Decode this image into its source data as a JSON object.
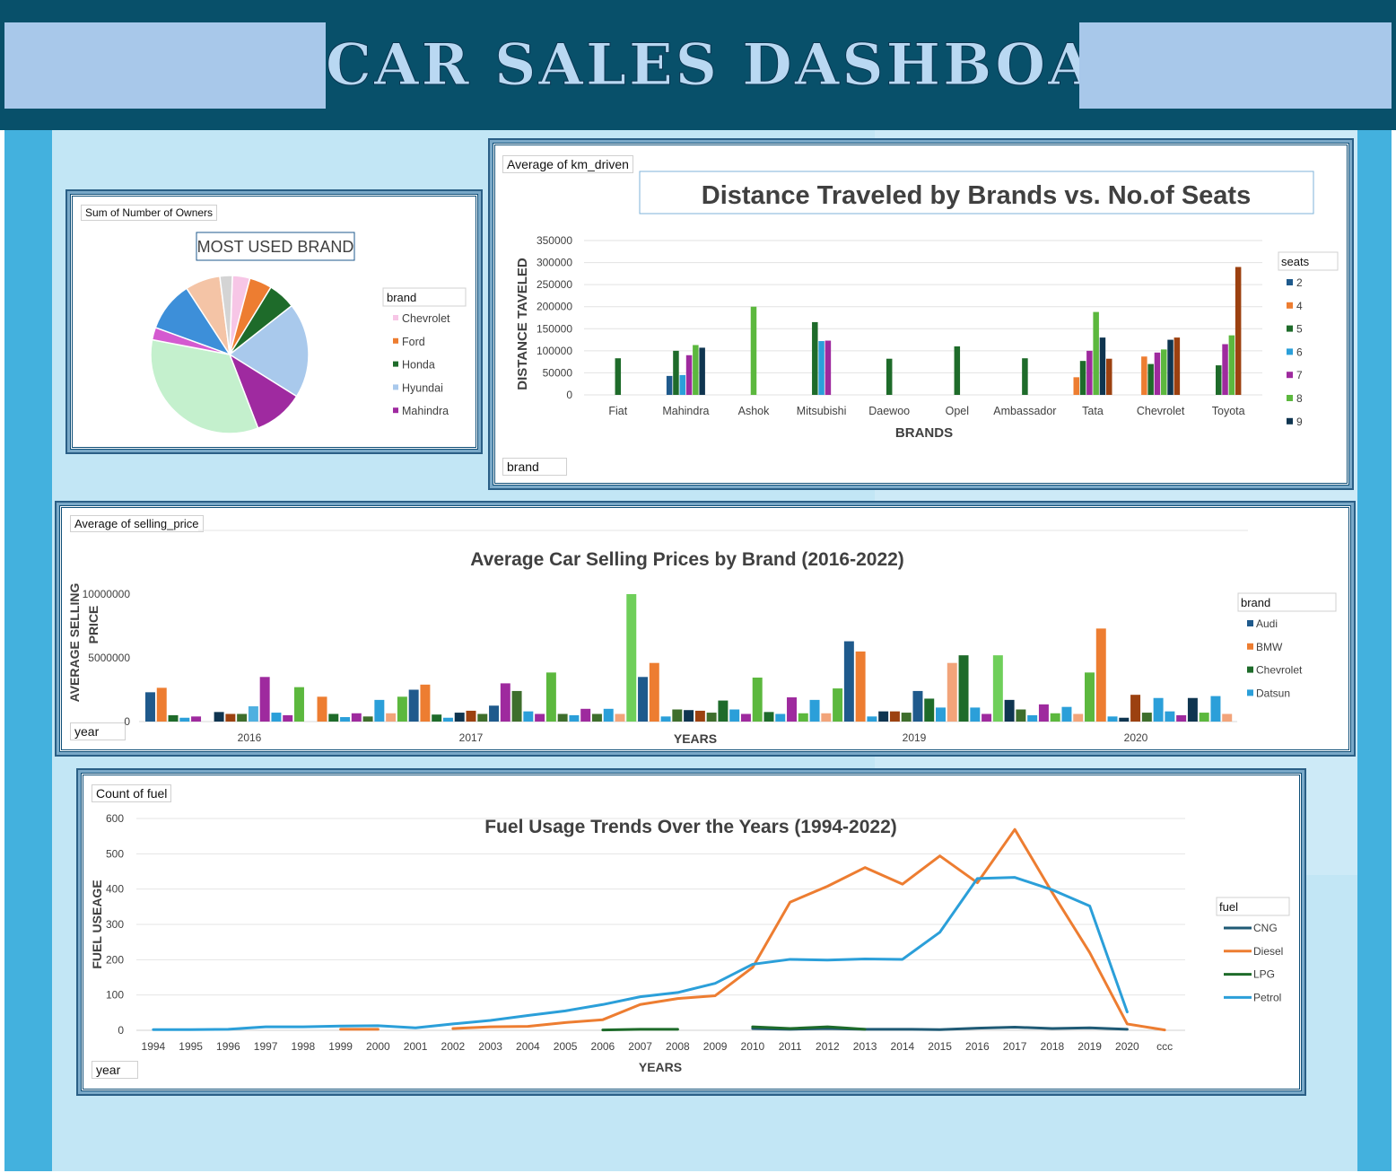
{
  "dashboard": {
    "title": "CAR SALES DASHBOARD"
  },
  "colors": {
    "banner_dark": "#08506a",
    "banner_light": "#a8c8ea",
    "side_blue": "#43b1de",
    "canvas": "#c2e6f5"
  },
  "pie_panel": {
    "field_button": "Sum of Number of Owners",
    "title": "MOST USED BRAND",
    "legend_title": "brand"
  },
  "bar1_panel": {
    "field_button": "Average of km_driven",
    "filter_button": "brand",
    "legend_title": "seats"
  },
  "bar2_panel": {
    "field_button": "Average of selling_price",
    "filter_button": "year",
    "legend_title": "brand"
  },
  "line_panel": {
    "field_button": "Count of fuel",
    "filter_button": "year",
    "legend_title": "fuel"
  },
  "chart_data": [
    {
      "type": "pie",
      "title": "MOST USED BRAND",
      "legend_title": "brand",
      "slices": [
        {
          "label": "Chevrolet",
          "value": 3.5,
          "color": "#f7c6e6"
        },
        {
          "label": "Ford",
          "value": 4.5,
          "color": "#ed7d31"
        },
        {
          "label": "Honda",
          "value": 5.5,
          "color": "#1e6b2a"
        },
        {
          "label": "Hyundai",
          "value": 19,
          "color": "#a9c9ec"
        },
        {
          "label": "Mahindra",
          "value": 10,
          "color": "#9f2aa0"
        },
        {
          "label": "",
          "value": 33,
          "color": "#c4f0cd"
        },
        {
          "label": "",
          "value": 2.5,
          "color": "#d45ad0"
        },
        {
          "label": "",
          "value": 10,
          "color": "#3d8fd9"
        },
        {
          "label": "",
          "value": 7,
          "color": "#f4c4a6"
        },
        {
          "label": "",
          "value": 2.5,
          "color": "#d4d4d4"
        }
      ],
      "legend": [
        "Chevrolet",
        "Ford",
        "Honda",
        "Hyundai",
        "Mahindra"
      ]
    },
    {
      "type": "bar",
      "title": "Distance Traveled by Brands vs. No.of Seats",
      "xlabel": "BRANDS",
      "ylabel": "DISTANCE TAVELED",
      "ylim": [
        0,
        350000
      ],
      "yticks": [
        0,
        50000,
        100000,
        150000,
        200000,
        250000,
        300000,
        350000
      ],
      "categories": [
        "Fiat",
        "Mahindra",
        "Ashok",
        "Mitsubishi",
        "Daewoo",
        "Opel",
        "Ambassador",
        "Tata",
        "Chevrolet",
        "Toyota"
      ],
      "legend_title": "seats",
      "series": [
        {
          "name": "2",
          "color": "#1f5a8c",
          "values": [
            null,
            43000,
            null,
            null,
            null,
            null,
            null,
            null,
            null,
            null
          ]
        },
        {
          "name": "4",
          "color": "#ed7d31",
          "values": [
            null,
            null,
            null,
            null,
            null,
            null,
            null,
            40000,
            87000,
            null
          ]
        },
        {
          "name": "5",
          "color": "#1e6b2a",
          "values": [
            83000,
            100000,
            null,
            165000,
            82000,
            110000,
            83000,
            77000,
            70000,
            67000
          ]
        },
        {
          "name": "6",
          "color": "#2b9fd9",
          "values": [
            null,
            45000,
            null,
            122000,
            null,
            null,
            null,
            null,
            null,
            null
          ]
        },
        {
          "name": "7",
          "color": "#9e2a9e",
          "values": [
            null,
            90000,
            null,
            123000,
            null,
            null,
            null,
            100000,
            96000,
            115000
          ]
        },
        {
          "name": "8",
          "color": "#5cb83e",
          "values": [
            null,
            113000,
            200000,
            null,
            null,
            null,
            null,
            188000,
            103000,
            135000
          ]
        },
        {
          "name": "9",
          "color": "#0f3550",
          "values": [
            null,
            107000,
            null,
            null,
            null,
            null,
            null,
            130000,
            125000,
            null
          ]
        },
        {
          "name": "",
          "color": "#9c4110",
          "values": [
            null,
            null,
            null,
            null,
            null,
            null,
            null,
            82000,
            130000,
            290000
          ]
        }
      ]
    },
    {
      "type": "bar",
      "title": "Average Car Selling Prices by Brand (2016-2022)",
      "xlabel": "YEARS",
      "ylabel": "AVERAGE SELLING PRICE",
      "ylim": [
        0,
        10000000
      ],
      "yticks": [
        0,
        5000000,
        10000000
      ],
      "year_labels": [
        "2016",
        "2017",
        "2019",
        "2020"
      ],
      "legend_title": "brand",
      "legend": [
        {
          "name": "Audi",
          "color": "#1f5a8c"
        },
        {
          "name": "BMW",
          "color": "#ed7d31"
        },
        {
          "name": "Chevrolet",
          "color": "#1e6b2a"
        },
        {
          "name": "Datsun",
          "color": "#2b9fd9"
        }
      ],
      "palette": [
        "#1f5a8c",
        "#ed7d31",
        "#1e6b2a",
        "#2b9fd9",
        "#9e2a9e",
        "#5cb83e",
        "#0f3550",
        "#9c4110",
        "#3e6e2c",
        "#4fb0e0",
        "#f2a47a",
        "#6fcf5a"
      ],
      "bars": [
        [
          2300000,
          0
        ],
        [
          2650000,
          1
        ],
        [
          500000,
          2
        ],
        [
          300000,
          3
        ],
        [
          400000,
          4
        ],
        [
          0,
          5
        ],
        [
          750000,
          6
        ],
        [
          600000,
          7
        ],
        [
          600000,
          8
        ],
        [
          1200000,
          9
        ],
        [
          3500000,
          4
        ],
        [
          700000,
          3
        ],
        [
          500000,
          4
        ],
        [
          2700000,
          5
        ],
        [
          0,
          6
        ],
        [
          1950000,
          1
        ],
        [
          600000,
          2
        ],
        [
          350000,
          3
        ],
        [
          650000,
          4
        ],
        [
          400000,
          8
        ],
        [
          1700000,
          3
        ],
        [
          650000,
          10
        ],
        [
          1950000,
          5
        ],
        [
          2500000,
          0
        ],
        [
          2900000,
          1
        ],
        [
          550000,
          2
        ],
        [
          300000,
          3
        ],
        [
          700000,
          6
        ],
        [
          850000,
          7
        ],
        [
          600000,
          8
        ],
        [
          1250000,
          0
        ],
        [
          3000000,
          4
        ],
        [
          2400000,
          8
        ],
        [
          800000,
          3
        ],
        [
          600000,
          4
        ],
        [
          3850000,
          5
        ],
        [
          600000,
          8
        ],
        [
          500000,
          3
        ],
        [
          1000000,
          4
        ],
        [
          600000,
          8
        ],
        [
          1000000,
          3
        ],
        [
          600000,
          10
        ],
        [
          10000000,
          11
        ],
        [
          3500000,
          0
        ],
        [
          4600000,
          1
        ],
        [
          400000,
          3
        ],
        [
          950000,
          8
        ],
        [
          900000,
          6
        ],
        [
          850000,
          7
        ],
        [
          700000,
          8
        ],
        [
          1650000,
          2
        ],
        [
          950000,
          3
        ],
        [
          600000,
          4
        ],
        [
          3450000,
          5
        ],
        [
          750000,
          2
        ],
        [
          600000,
          3
        ],
        [
          1900000,
          4
        ],
        [
          650000,
          5
        ],
        [
          1700000,
          3
        ],
        [
          650000,
          10
        ],
        [
          2600000,
          5
        ],
        [
          6300000,
          0
        ],
        [
          5500000,
          1
        ],
        [
          400000,
          3
        ],
        [
          800000,
          6
        ],
        [
          800000,
          7
        ],
        [
          700000,
          8
        ],
        [
          2400000,
          0
        ],
        [
          1800000,
          2
        ],
        [
          1100000,
          3
        ],
        [
          4600000,
          10
        ],
        [
          5200000,
          2
        ],
        [
          1100000,
          3
        ],
        [
          600000,
          4
        ],
        [
          5200000,
          11
        ],
        [
          1700000,
          6
        ],
        [
          950000,
          8
        ],
        [
          500000,
          3
        ],
        [
          1350000,
          4
        ],
        [
          650000,
          5
        ],
        [
          1150000,
          3
        ],
        [
          600000,
          10
        ],
        [
          3850000,
          5
        ],
        [
          7300000,
          1
        ],
        [
          400000,
          3
        ],
        [
          300000,
          6
        ],
        [
          2100000,
          7
        ],
        [
          700000,
          8
        ],
        [
          1850000,
          3
        ],
        [
          800000,
          3
        ],
        [
          500000,
          4
        ],
        [
          1850000,
          6
        ],
        [
          700000,
          5
        ],
        [
          2000000,
          3
        ],
        [
          600000,
          10
        ]
      ]
    },
    {
      "type": "line",
      "title": "Fuel Usage Trends Over the Years (1994-2022)",
      "xlabel": "YEARS",
      "ylabel": "FUEL USEAGE",
      "ylim": [
        0,
        600
      ],
      "yticks": [
        0,
        100,
        200,
        300,
        400,
        500,
        600
      ],
      "categories": [
        "1994",
        "1995",
        "1996",
        "1997",
        "1998",
        "1999",
        "2000",
        "2001",
        "2002",
        "2003",
        "2004",
        "2005",
        "2006",
        "2007",
        "2008",
        "2009",
        "2010",
        "2011",
        "2012",
        "2013",
        "2014",
        "2015",
        "2016",
        "2017",
        "2018",
        "2019",
        "2020",
        "ccc"
      ],
      "legend_title": "fuel",
      "series": [
        {
          "name": "CNG",
          "color": "#1f5a75",
          "values": [
            null,
            null,
            null,
            null,
            null,
            null,
            null,
            null,
            null,
            null,
            null,
            null,
            null,
            null,
            null,
            null,
            5,
            3,
            5,
            3,
            3,
            2,
            6,
            9,
            5,
            7,
            3,
            null
          ]
        },
        {
          "name": "Diesel",
          "color": "#ed7d31",
          "values": [
            null,
            null,
            null,
            null,
            null,
            3,
            3,
            null,
            5,
            10,
            11,
            22,
            30,
            73,
            90,
            98,
            178,
            363,
            408,
            461,
            414,
            494,
            418,
            569,
            390,
            220,
            18,
            1
          ]
        },
        {
          "name": "LPG",
          "color": "#1e6b2a",
          "values": [
            null,
            null,
            null,
            null,
            null,
            null,
            null,
            null,
            null,
            null,
            null,
            null,
            1,
            3,
            3,
            null,
            10,
            5,
            10,
            3,
            null,
            null,
            null,
            null,
            null,
            null,
            null,
            null
          ]
        },
        {
          "name": "Petrol",
          "color": "#2b9fd9",
          "values": [
            2,
            2,
            3,
            10,
            10,
            12,
            13,
            7,
            18,
            28,
            42,
            55,
            73,
            95,
            107,
            133,
            187,
            201,
            199,
            202,
            201,
            278,
            430,
            433,
            398,
            352,
            52,
            null
          ]
        }
      ]
    }
  ]
}
